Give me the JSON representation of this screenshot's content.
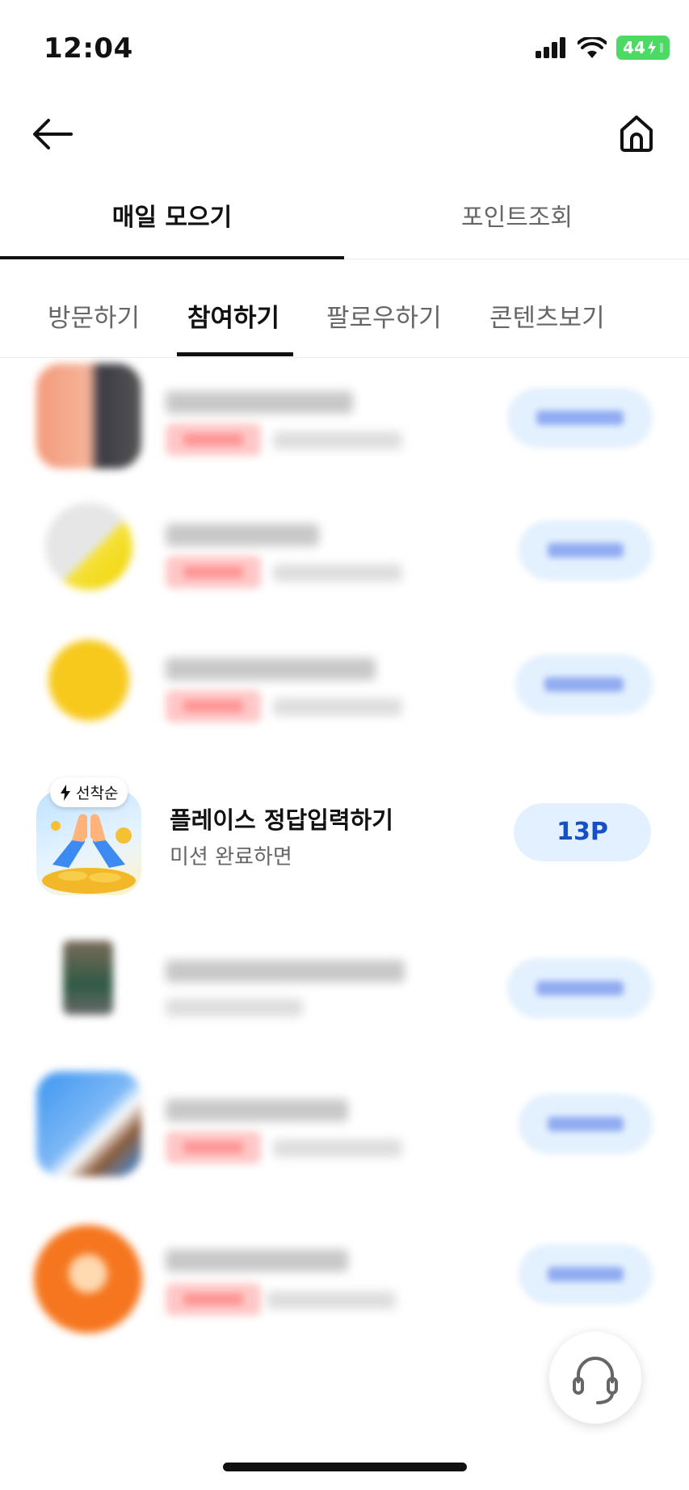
{
  "status_bar": {
    "time": "12:04",
    "battery": "44"
  },
  "main_tabs": [
    {
      "label": "매일 모으기",
      "active": true
    },
    {
      "label": "포인트조회",
      "active": false
    }
  ],
  "sub_tabs": [
    {
      "label": "방문하기",
      "active": false
    },
    {
      "label": "참여하기",
      "active": true
    },
    {
      "label": "팔로우하기",
      "active": false
    },
    {
      "label": "콘텐츠보기",
      "active": false
    }
  ],
  "featured_item": {
    "badge": "선착순",
    "title": "플레이스 정답입력하기",
    "subtitle": "미션 완료하면",
    "points": "13P"
  },
  "icons": {
    "back": "arrow-left-icon",
    "home": "home-icon",
    "support": "headset-icon",
    "badge": "lightning-icon"
  },
  "colors": {
    "accent_text": "#1550c6",
    "pill_background": "#e2f0ff",
    "battery": "#4cd964"
  }
}
